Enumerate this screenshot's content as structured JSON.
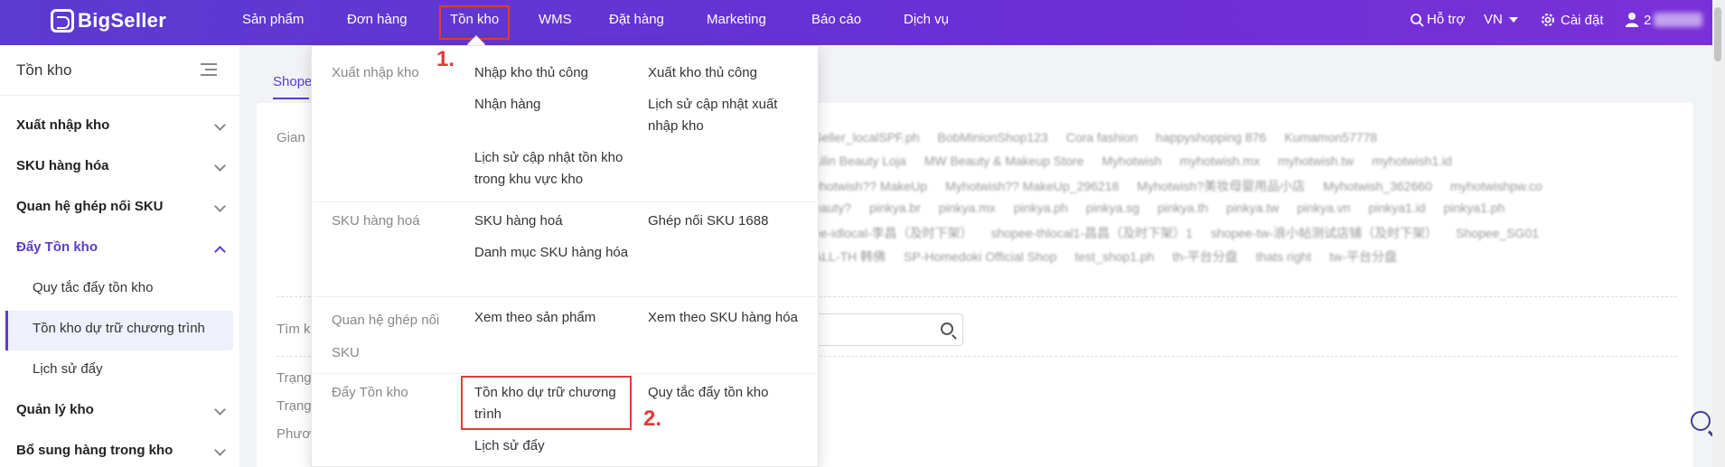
{
  "brand": {
    "name": "BigSeller"
  },
  "nav": {
    "items": [
      "Sản phẩm",
      "Đơn hàng",
      "Tồn kho",
      "WMS",
      "Đặt hàng",
      "Marketing",
      "Báo cáo",
      "Dịch vụ"
    ],
    "active": "Tồn kho"
  },
  "topbar": {
    "help": "Hỗ trợ",
    "language": "VN",
    "settings": "Cài đặt",
    "user_prefix": "2"
  },
  "sidebar": {
    "title": "Tồn kho",
    "groups": [
      {
        "label": "Xuất nhập kho"
      },
      {
        "label": "SKU hàng hóa"
      },
      {
        "label": "Quan hệ ghép nối SKU"
      },
      {
        "label": "Đẩy Tồn kho"
      },
      {
        "label": "Quản lý kho"
      },
      {
        "label": "Bổ sung hàng trong kho"
      }
    ],
    "subitems": [
      "Quy tắc đẩy tồn kho",
      "Tồn kho dự trữ chương trình",
      "Lịch sử đẩy"
    ]
  },
  "main": {
    "tab": "Shope",
    "labels": {
      "gian": "Gian",
      "tim": "Tìm k",
      "trang1": "Trạng",
      "trang2": "Trạng",
      "phuong": "Phươ"
    },
    "shops": [
      [
        "Seller_localSPF.ph",
        "BobMinionShop123",
        "Cora fashion",
        "happyshopping 876",
        "Kumamon57778"
      ],
      [
        "Lilin Beauty Loja",
        "MW Beauty & Makeup Store",
        "Myhotwish",
        "myhotwish.mx",
        "myhotwish.tw",
        "myhotwish1.id"
      ],
      [
        "yhotwish?? MakeUp",
        "Myhotwish?? MakeUp_296218",
        "Myhotwish?美妆母婴用品小店",
        "Myhotwish_362660",
        "myhotwishpw.co"
      ],
      [
        "eauty?",
        "pinkya.br",
        "pinkya.mx",
        "pinkya.ph",
        "pinkya.sg",
        "pinkya.th",
        "pinkya.tw",
        "pinkya.vn",
        "pinkya1.id",
        "pinkya1.ph"
      ],
      [
        "ee-idlocal-李昌（及时下架）",
        "shopee-thlocal1-昌昌（及时下架）1",
        "shopee-tw-浪小帖测试店铺（及时下架）",
        "Shopee_SG01"
      ],
      [
        "ALL-TH 韩佛",
        "SP-Homedoki Official Shop",
        "test_shop1.ph",
        "th-平台分盘",
        "thats right",
        "tw-平台分盘"
      ]
    ]
  },
  "dropdown": {
    "groups": [
      {
        "label": "Xuất nhập kho",
        "links": [
          "Nhập kho thủ công",
          "Xuất kho thủ công",
          "Nhận hàng",
          "Lịch sử cập nhật xuất nhập kho",
          "Lịch sử cập nhật tồn kho trong khu vực kho"
        ]
      },
      {
        "label": "SKU hàng hoá",
        "links": [
          "SKU hàng hoá",
          "Ghép nối SKU 1688",
          "Danh mục SKU hàng hóa"
        ]
      },
      {
        "label": "Quan hệ ghép nối SKU",
        "links": [
          "Xem theo sản phẩm",
          "Xem theo SKU hàng hóa"
        ]
      },
      {
        "label": "Đẩy Tồn kho",
        "links": [
          "Tồn kho dự trữ chương trình",
          "Quy tắc đẩy tồn kho",
          "Lịch sử đẩy"
        ]
      }
    ]
  },
  "annotations": {
    "step1": "1.",
    "step2": "2."
  },
  "colors": {
    "brand": "#5b3bd1",
    "highlight": "#e53935"
  }
}
